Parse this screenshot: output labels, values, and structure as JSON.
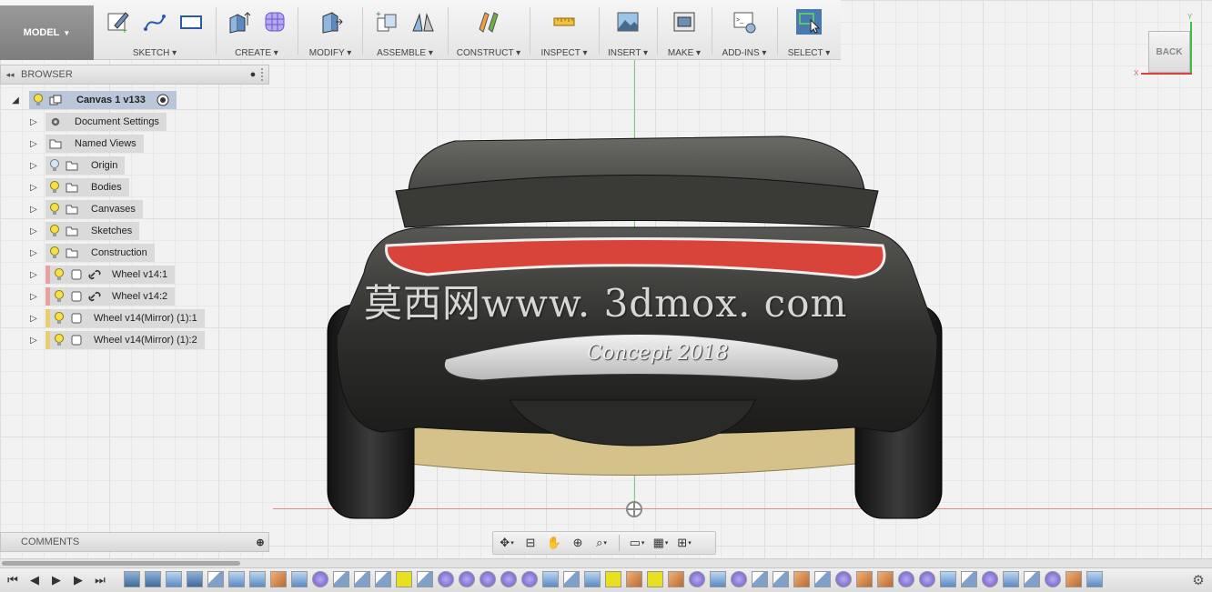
{
  "workspace": {
    "label": "MODEL"
  },
  "toolbar": {
    "groups": [
      {
        "label": "SKETCH"
      },
      {
        "label": "CREATE"
      },
      {
        "label": "MODIFY"
      },
      {
        "label": "ASSEMBLE"
      },
      {
        "label": "CONSTRUCT"
      },
      {
        "label": "INSPECT"
      },
      {
        "label": "INSERT"
      },
      {
        "label": "MAKE"
      },
      {
        "label": "ADD-INS"
      },
      {
        "label": "SELECT"
      }
    ]
  },
  "viewcube": {
    "face_label": "BACK",
    "axis_x": "X",
    "axis_y": "Y"
  },
  "browser": {
    "title": "BROWSER",
    "root": {
      "label": "Canvas 1 v133"
    },
    "items": [
      {
        "label": "Document Settings",
        "icon": "gear-icon"
      },
      {
        "label": "Named Views",
        "icon": "folder-icon"
      },
      {
        "label": "Origin",
        "icon": "folder-icon"
      },
      {
        "label": "Bodies",
        "icon": "folder-icon"
      },
      {
        "label": "Canvases",
        "icon": "folder-icon"
      },
      {
        "label": "Sketches",
        "icon": "folder-icon"
      },
      {
        "label": "Construction",
        "icon": "folder-icon"
      },
      {
        "label": "Wheel v14:1",
        "icon": "component-icon"
      },
      {
        "label": "Wheel v14:2",
        "icon": "component-icon"
      },
      {
        "label": "Wheel v14(Mirror) (1):1",
        "icon": "component-icon"
      },
      {
        "label": "Wheel v14(Mirror) (1):2",
        "icon": "component-icon"
      }
    ]
  },
  "comments": {
    "title": "COMMENTS"
  },
  "canvas": {
    "watermark": "莫西网www. 3dmox. com",
    "badge": "Concept 2018"
  },
  "colors": {
    "accent_blue": "#4a79b0",
    "car_body": "#2e2e2c",
    "underbody": "#d4c28a",
    "taillight": "#d8443a"
  }
}
